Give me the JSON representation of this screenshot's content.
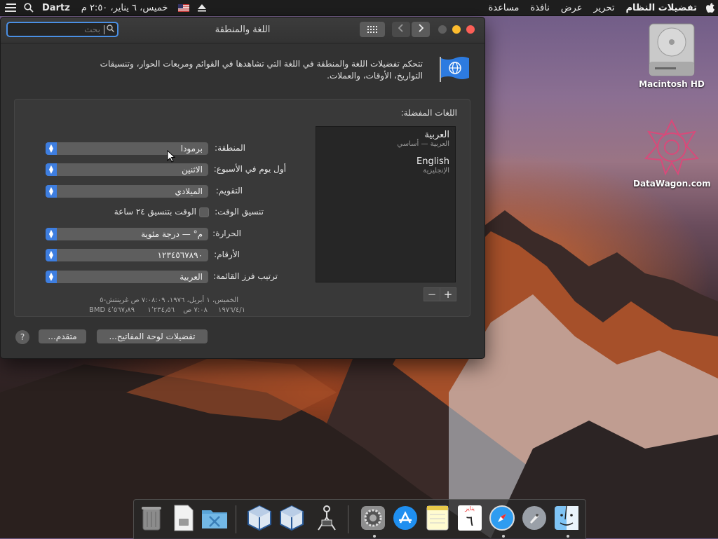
{
  "menubar": {
    "app_name": "تفضيلات النظام",
    "menus": [
      "تحرير",
      "عرض",
      "نافذة",
      "مساعدة"
    ],
    "datetime": "خميس، ٦ يناير، ٢:٥٠ م",
    "user": "Dartz"
  },
  "window": {
    "title": "اللغة والمنطقة",
    "search_placeholder": "بحث",
    "description": "تتحكم تفضيلات اللغة والمنطقة في اللغة التي تشاهدها في القوائم ومربعات الحوار، وتنسيقات التواريخ، الأوقات، والعملات.",
    "preferred_languages_title": "اللغات المفضلة:",
    "languages": [
      {
        "name": "العربية",
        "sub": "العربية — أساسي"
      },
      {
        "name": "English",
        "sub": "الإنجليزية"
      }
    ],
    "add_label": "+",
    "remove_label": "−",
    "settings": {
      "region_label": "المنطقة:",
      "region_value": "برمودا",
      "first_day_label": "أول يوم في الأسبوع:",
      "first_day_value": "الاثنين",
      "calendar_label": "التقويم:",
      "calendar_value": "الميلادي",
      "time_format_label": "تنسيق الوقت:",
      "time_format_checkbox": "الوقت بتنسيق ٢٤ ساعة",
      "temperature_label": "الحرارة:",
      "temperature_value": "م° — درجة مئوية",
      "numbers_label": "الأرقام:",
      "numbers_value": "١٢٣٤٥٦٧٨٩٠",
      "sort_label": "ترتيب فرز القائمة:",
      "sort_value": "العربية"
    },
    "sample_line1": "الخميس، ١ أبريل، ١٩٧٦، ٧:٠٨:٠٩ ص غرينتش-٥",
    "sample_date": "١٩٧٦/٤/١",
    "sample_time": "٧:٠٨ ص",
    "sample_number": "١٬٢٣٤٫٥٦",
    "sample_currency": "٤٬٥٦٧٫٨٩ BMD",
    "keyboard_prefs_button": "تفضيلات لوحة المفاتيح...",
    "advanced_button": "متقدم...",
    "help_label": "?"
  },
  "desktop": {
    "hd_label": "Macintosh HD",
    "site_label": "DataWagon.com"
  },
  "dock": {
    "calendar_month": "يناير",
    "calendar_day": "٦"
  }
}
